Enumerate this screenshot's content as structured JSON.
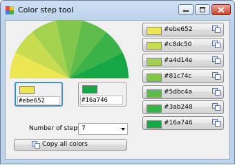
{
  "window": {
    "title": "Color step tool"
  },
  "icons": {
    "app": "palette-icon",
    "copy": "copy-icon"
  },
  "controls": {
    "minimize": "minimize-icon",
    "maximize": "maximize-icon",
    "close": "close-icon"
  },
  "fan_colors": [
    "#ebe652",
    "#c8dc50",
    "#a4d14e",
    "#81c74c",
    "#5dbc4a",
    "#3ab248",
    "#16a746"
  ],
  "start": {
    "color": "#ebe652",
    "value": "#ebe652"
  },
  "end": {
    "color": "#16a746",
    "value": "#16a746"
  },
  "steps": {
    "label": "Number of steps",
    "value": "7"
  },
  "copy_all_label": "Copy all colors",
  "colors": [
    {
      "hex": "#ebe652",
      "label": "#ebe652"
    },
    {
      "hex": "#c8dc50",
      "label": "#c8dc50"
    },
    {
      "hex": "#a4d14e",
      "label": "#a4d14e"
    },
    {
      "hex": "#81c74c",
      "label": "#81c74c"
    },
    {
      "hex": "#5dbc4a",
      "label": "#5dbc4a"
    },
    {
      "hex": "#3ab248",
      "label": "#3ab248"
    },
    {
      "hex": "#16a746",
      "label": "#16a746"
    }
  ]
}
